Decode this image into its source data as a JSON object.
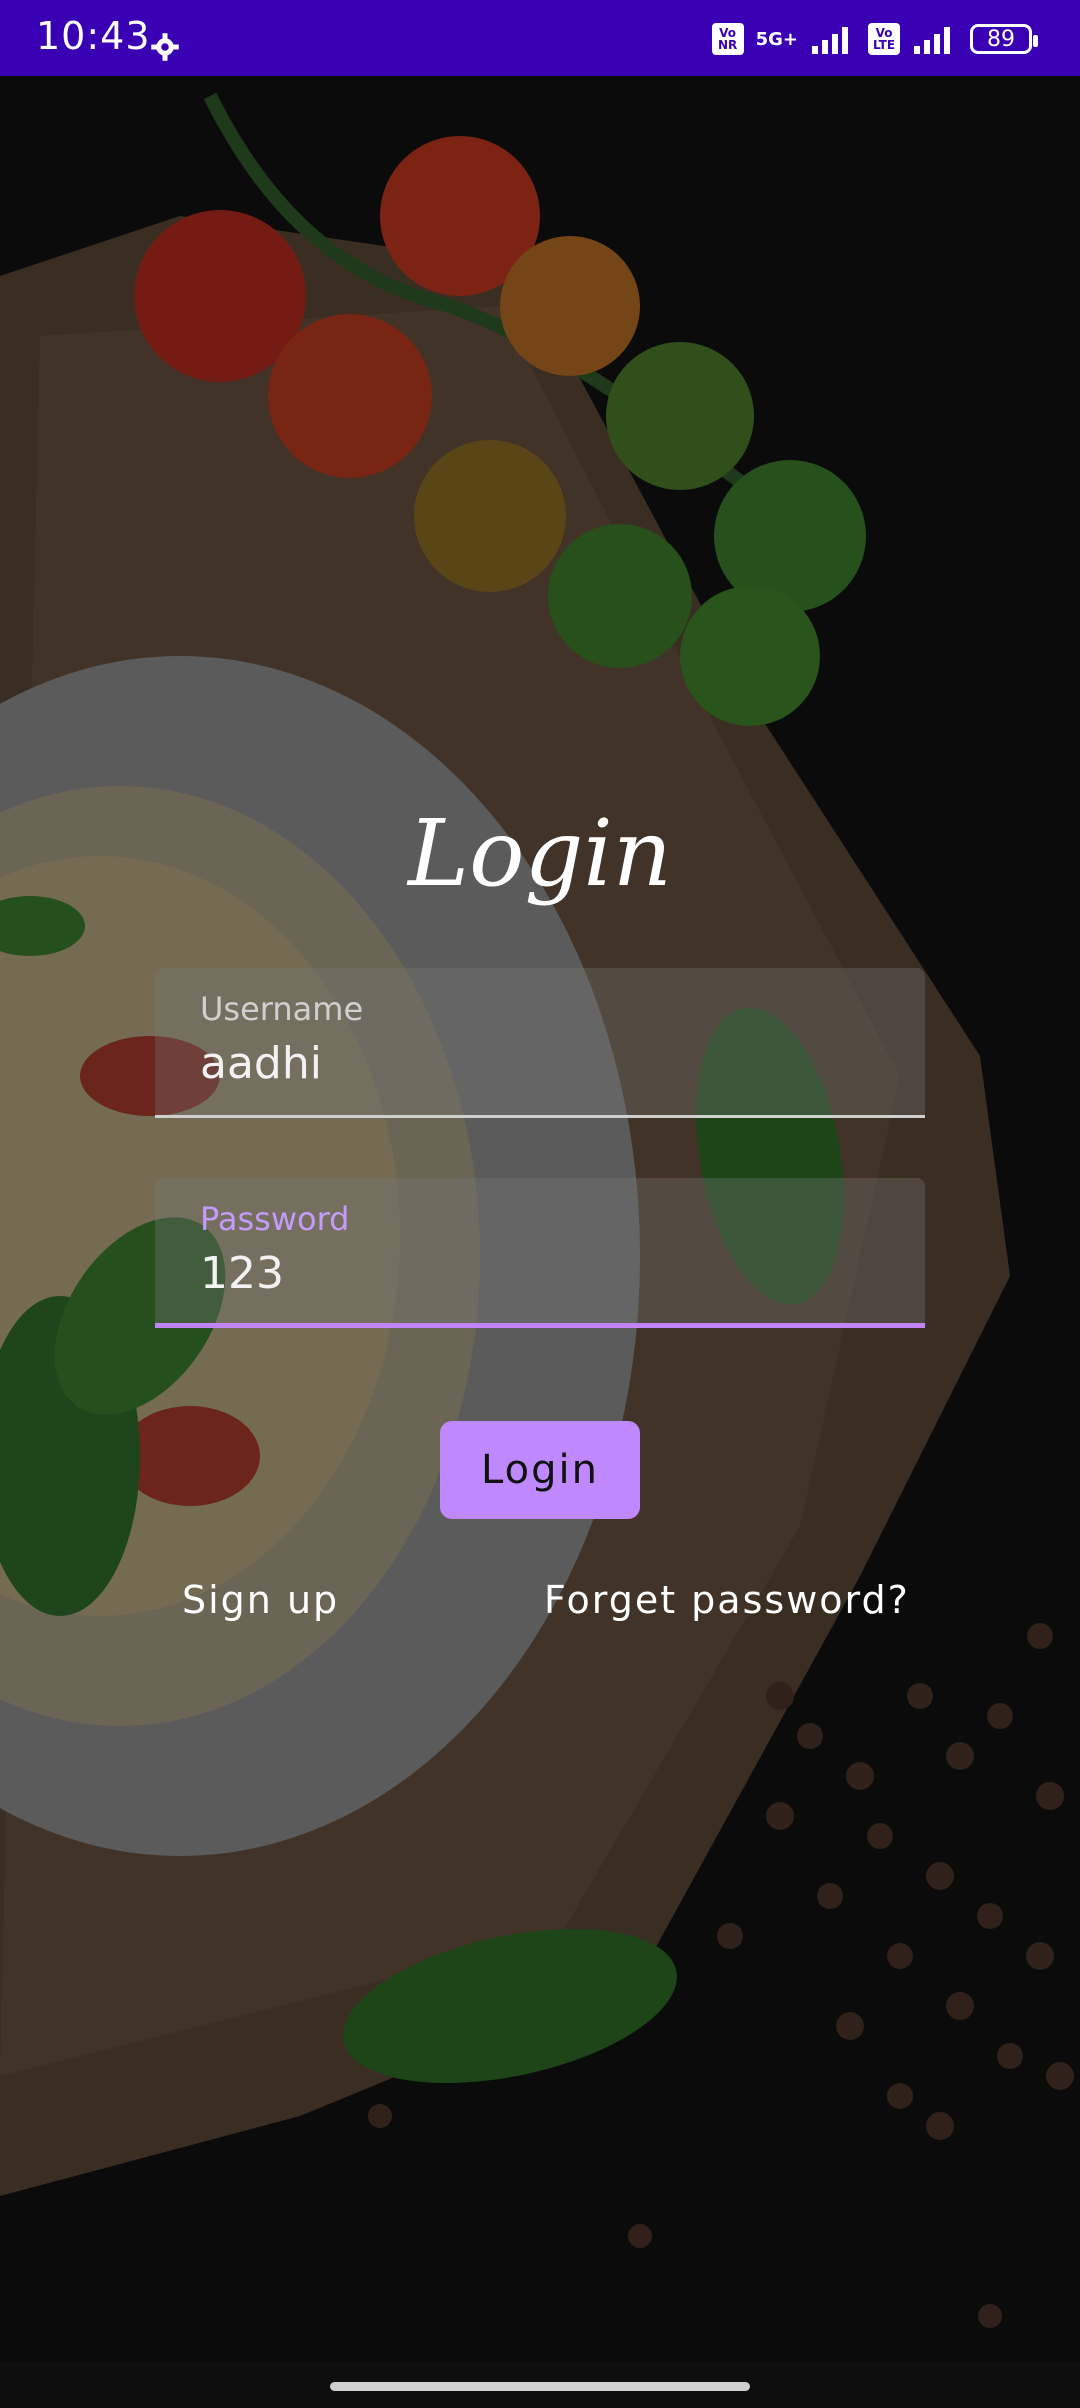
{
  "status_bar": {
    "time": "10:43",
    "network_badges": [
      "Vo NR",
      "Vo LTE"
    ],
    "network_label": "5G+",
    "battery": "89"
  },
  "login": {
    "title": "Login",
    "username_label": "Username",
    "username_value": "aadhi",
    "password_label": "Password",
    "password_value": "123",
    "login_button": "Login",
    "signup_link": "Sign up",
    "forget_link": "Forget password?"
  },
  "colors": {
    "status_bar_bg": "#3a00b4",
    "accent": "#bf88fc",
    "background": "#121212"
  },
  "icons": [
    "gear-icon",
    "signal-icon",
    "battery-icon"
  ]
}
